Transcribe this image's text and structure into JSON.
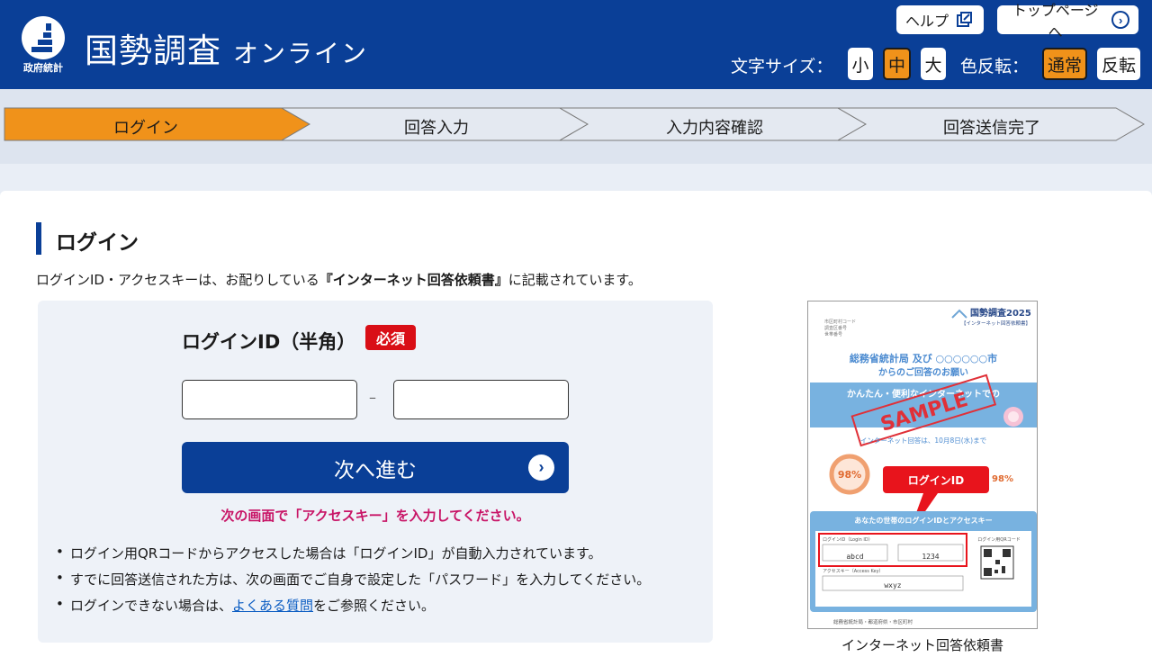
{
  "header": {
    "logo_caption": "政府統計",
    "title": "国勢調査",
    "title_online": "オンライン",
    "help_label": "ヘルプ",
    "top_label": "トップページへ",
    "font_size_label": "文字サイズ：",
    "font_sizes": [
      "小",
      "中",
      "大"
    ],
    "font_size_selected": "中",
    "color_invert_label": "色反転：",
    "color_modes": [
      "通常",
      "反転"
    ],
    "color_mode_selected": "通常"
  },
  "steps": [
    {
      "label": "ログイン",
      "active": true
    },
    {
      "label": "回答入力",
      "active": false
    },
    {
      "label": "入力内容確認",
      "active": false
    },
    {
      "label": "回答送信完了",
      "active": false
    }
  ],
  "colors": {
    "brand_blue": "#0a3f97",
    "active_orange": "#f0921a",
    "required_red": "#d90e16",
    "note_pink": "#c81466"
  },
  "main": {
    "heading": "ログイン",
    "intro_before": "ログインID・アクセスキーは、お配りしている",
    "intro_bold": "『インターネット回答依頼書』",
    "intro_after": "に記載されています。",
    "field_label": "ログインID（半角）",
    "required_badge": "必須",
    "input1_value": "",
    "input2_value": "",
    "separator": "–",
    "next_button": "次へ進む",
    "next_note": "次の画面で「アクセスキー」を入力してください。",
    "bullets": [
      "ログイン用QRコードからアクセスした場合は「ログインID」が自動入力されています。",
      "すでに回答送信された方は、次の画面でご自身で設定した「パスワード」を入力してください。"
    ],
    "bullet3_before": "ログインできない場合は、",
    "bullet3_link": "よくある質問",
    "bullet3_after": "をご参照ください。"
  },
  "sample_doc": {
    "caption": "インターネット回答依頼書",
    "doc_title": "国勢調査2025",
    "doc_subtitle": "【インターネット回答依頼書】",
    "meta_lines": [
      "市区町村コード",
      "調査区番号",
      "世帯番号"
    ],
    "greeting_line1": "総務省統計局 及び ○○○○○○市",
    "greeting_line2": "からのご回答のお願い",
    "banner_line": "かんたん・便利なインターネットでの",
    "sample_stamp": "SAMPLE",
    "deadline": "インターネット回答は、10月8日(水)まで",
    "percent_left": "98%",
    "percent_right": "98%",
    "callout": "ログインID",
    "section_title": "あなたの世帯のログインIDとアクセスキー",
    "login_id_label": "ログインID（Login ID）",
    "login_id_part1": "abcd",
    "login_id_part2": "1234",
    "access_key_label": "アクセスキー（Access Key）",
    "access_key": "wxyz",
    "qr_label": "ログイン用QRコード",
    "footer": "総務省統計局・都道府県・市区町村"
  }
}
